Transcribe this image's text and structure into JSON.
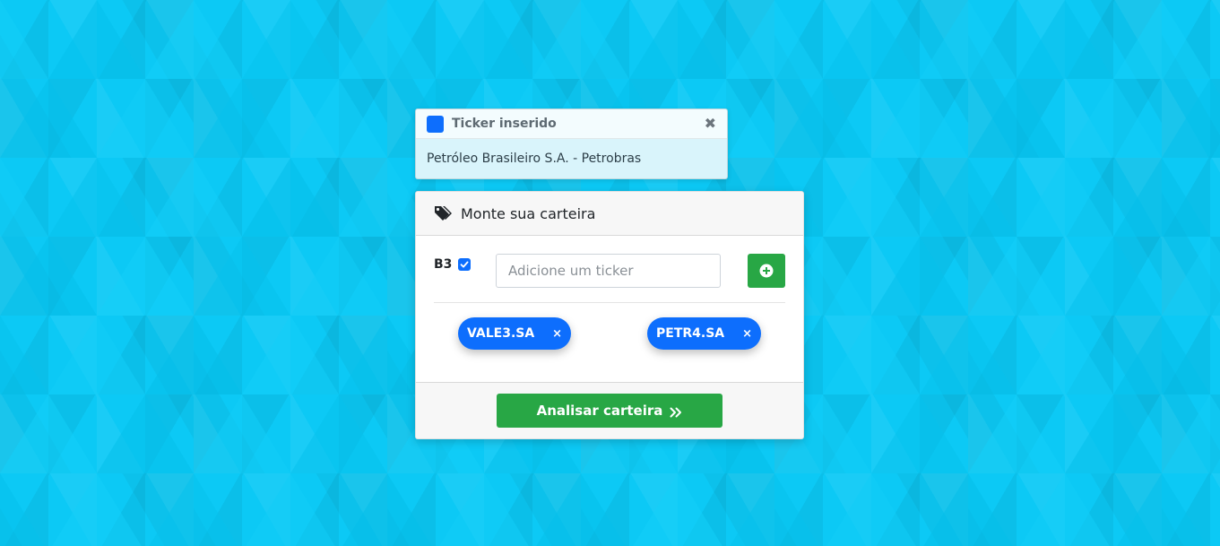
{
  "colors": {
    "background": "#0cc9f5",
    "primary": "#0d6efd",
    "success": "#28a745"
  },
  "toast": {
    "title": "Ticker inserido",
    "message": "Petróleo Brasileiro S.A. - Petrobras",
    "close_icon": "close-icon"
  },
  "card": {
    "header_icon": "tags-icon",
    "title": "Monte sua carteira",
    "exchange_label": "B3",
    "exchange_checked": true,
    "input_placeholder": "Adicione um ticker",
    "input_value": "",
    "add_icon": "plus-circle-icon",
    "tickers": [
      {
        "label": "VALE3.SA",
        "remove": "×"
      },
      {
        "label": "PETR4.SA",
        "remove": "×"
      }
    ],
    "analyze_label": "Analisar carteira",
    "analyze_icon": "double-chevron-right-icon"
  }
}
